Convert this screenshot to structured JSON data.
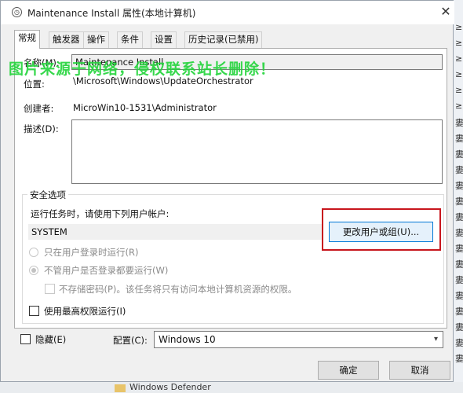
{
  "window": {
    "title": "Maintenance Install 属性(本地计算机)",
    "close_symbol": "✕"
  },
  "tabs": [
    {
      "label": "常规",
      "active": true
    },
    {
      "label": "触发器"
    },
    {
      "label": "操作"
    },
    {
      "label": "条件"
    },
    {
      "label": "设置"
    },
    {
      "label": "历史记录(已禁用)"
    }
  ],
  "watermark": "图片来源于网络，侵权联系站长删除！",
  "general": {
    "name_label": "名称(M):",
    "name_value": "Maintenance Install",
    "location_label": "位置:",
    "location_value": "\\Microsoft\\Windows\\UpdateOrchestrator",
    "author_label": "创建者:",
    "author_value": "MicroWin10-1531\\Administrator",
    "description_label": "描述(D):",
    "description_value": ""
  },
  "security": {
    "legend": "安全选项",
    "run_as_label": "运行任务时，请使用下列用户帐户:",
    "user_account": "SYSTEM",
    "change_user_button": "更改用户或组(U)...",
    "radio_logged_on": "只在用户登录时运行(R)",
    "radio_whether_logged_on": "不管用户是否登录都要运行(W)",
    "no_store_password": "不存储密码(P)。该任务将只有访问本地计算机资源的权限。",
    "highest_privileges": "使用最高权限运行(I)"
  },
  "footer": {
    "hidden_label": "隐藏(E)",
    "config_label": "配置(C):",
    "config_value": "Windows 10",
    "ok_button": "确定",
    "cancel_button": "取消"
  },
  "background": {
    "strip_chars": [
      "≥",
      "≥",
      "≥",
      "≥",
      "≥",
      "≥",
      "婁",
      "婁",
      "婁",
      "婁",
      "婁",
      "婁",
      "婁",
      "婁",
      "婁",
      "婁",
      "婁",
      "婁",
      "婁",
      "婁",
      "婁",
      "婁"
    ],
    "bottom_item": "Windows Defender"
  },
  "colors": {
    "highlight_border": "#c8161d",
    "watermark": "#22d43a",
    "primary_button_border": "#0078d7"
  }
}
